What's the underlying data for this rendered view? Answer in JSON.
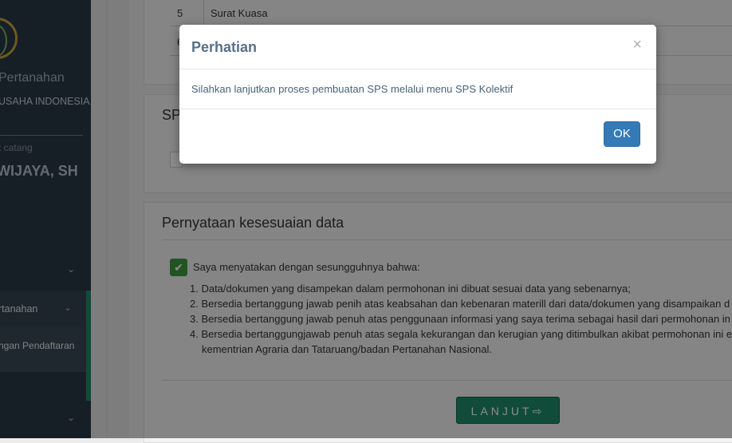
{
  "sidebar": {
    "title": "Pertanahan",
    "subtitle": "USAHA INDONESIA",
    "role": "t catang",
    "user_name": "WIJAYA, SH",
    "menu_item_1": "rtanahan",
    "menu_item_2": "ngan Pendaftaran"
  },
  "table": {
    "row_5": {
      "no": "5",
      "name": "Surat Kuasa"
    },
    "row_6_no": "6"
  },
  "sps_panel": {
    "title_fragment": "SP"
  },
  "declaration": {
    "title": "Pernyataan kesesuaian data",
    "checkbox_label": "Saya menyatakan dengan sesungguhnya bahwa:",
    "items": [
      "1. Data/dokumen yang disampekan dalam permohonan ini dibuat sesuai data yang sebenarnya;",
      "2. Bersedia bertanggung jawab penih atas keabsahan dan kebenaran materill dari data/dokumen yang disampaikan d",
      "3. Bersedia bertanggung jawab penuh atas penggunaan informasi yang saya terima sebagai hasil dari permohonan in",
      "4. Bersedia bertanggungjawab penuh atas segala kekurangan dan kerugian yang ditimbulkan akibat permohonan ini e",
      "kementrian Agraria dan Tataruang/badan Pertanahan Nasional."
    ],
    "submit_label": "LANJUT⇨"
  },
  "modal": {
    "title": "Perhatian",
    "close_symbol": "×",
    "message": "Silahkan lanjutkan proses pembuatan SPS melalui menu SPS Kolektif",
    "ok_label": "OK"
  }
}
